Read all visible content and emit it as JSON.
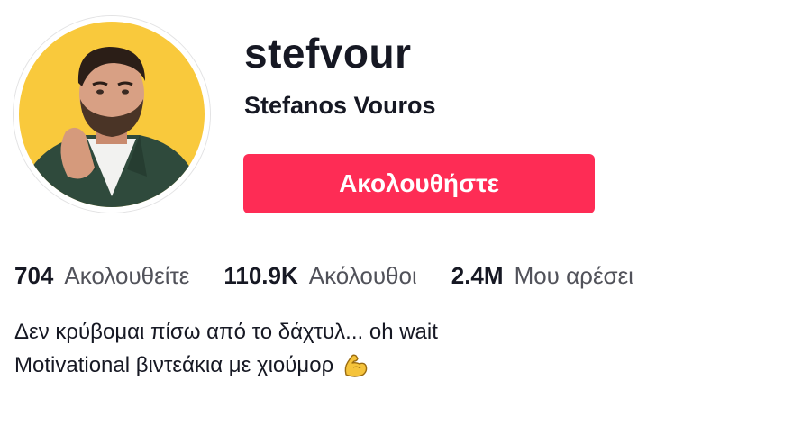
{
  "profile": {
    "username": "stefvour",
    "display_name": "Stefanos Vouros",
    "follow_label": "Ακολουθήστε",
    "avatar_icon": "profile-photo"
  },
  "stats": [
    {
      "value": "704",
      "label": "Ακολουθείτε"
    },
    {
      "value": "110.9K",
      "label": "Ακόλουθοι"
    },
    {
      "value": "2.4M",
      "label": "Μου αρέσει"
    }
  ],
  "bio": {
    "line1": "Δεν κρύβομαι πίσω από το δάχτυλ... oh wait",
    "line2": "Motivational βιντεάκια με χιούμορ",
    "line2_emoji": "flexed-biceps-icon"
  },
  "colors": {
    "accent": "#fe2c55",
    "text": "#161823",
    "muted": "#51525a",
    "avatar_bg": "#f9c93c"
  }
}
